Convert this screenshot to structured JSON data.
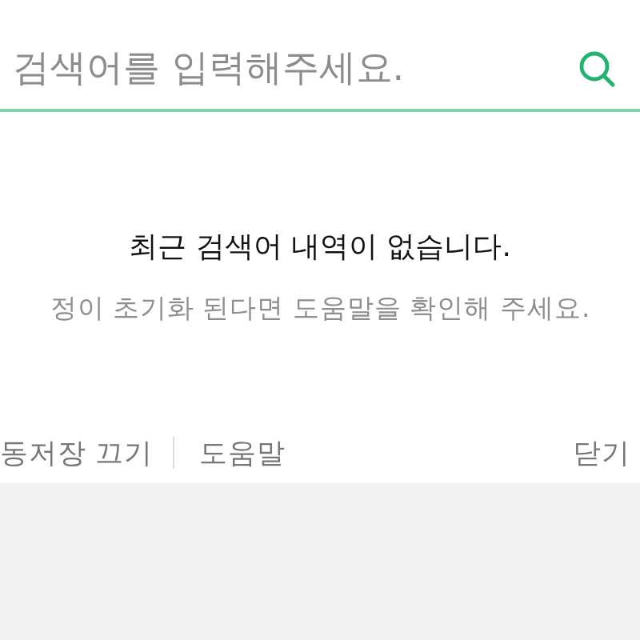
{
  "search": {
    "placeholder": "검색어를 입력해주세요."
  },
  "empty_state": {
    "title": "최근 검색어 내역이 없습니다.",
    "hint": "정이 초기화 된다면 도움말을 확인해 주세요."
  },
  "footer": {
    "left_links": [
      "동저장 끄기",
      "도움말"
    ],
    "close": "닫기"
  }
}
